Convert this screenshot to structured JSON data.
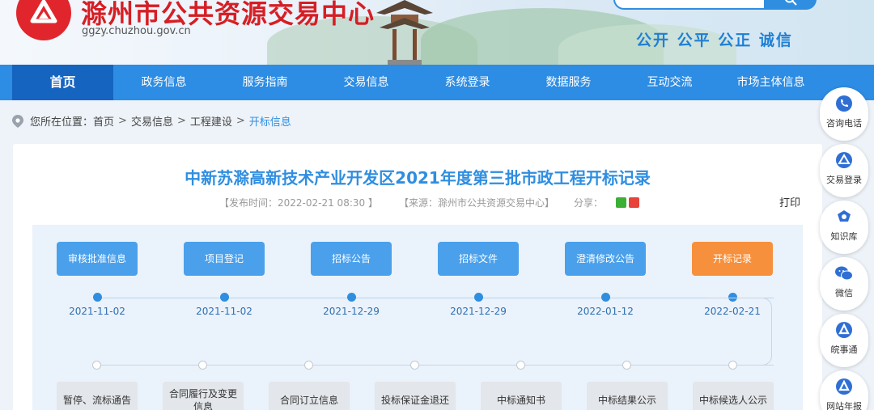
{
  "header": {
    "site_title": "滁州市公共资源交易中心",
    "domain": "ggzy.chuzhou.gov.cn",
    "slogan": "公开 公平 公正 诚信",
    "search_placeholder": "",
    "colors": {
      "title": "#d61e24",
      "accent": "#2f8ee0"
    }
  },
  "nav": {
    "items": [
      "首页",
      "政务信息",
      "服务指南",
      "交易信息",
      "系统登录",
      "数据服务",
      "互动交流",
      "市场主体信息"
    ],
    "active_index": 0
  },
  "breadcrumb": {
    "prefix": "您所在位置：",
    "items": [
      "首页",
      "交易信息",
      "工程建设",
      "开标信息"
    ],
    "separator": ">"
  },
  "article": {
    "title": "中新苏滁高新技术产业开发区2021年度第三批市政工程开标记录",
    "publish_time": "【发布时间：2022-02-21 08:30 】",
    "source": "【来源：滁州市公共资源交易中心】",
    "share_label": "分享：",
    "print_label": "打印"
  },
  "flow": {
    "stages": [
      {
        "label": "审核批准信息",
        "date": "2021-11-02",
        "active": false
      },
      {
        "label": "项目登记",
        "date": "2021-11-02",
        "active": false
      },
      {
        "label": "招标公告",
        "date": "2021-12-29",
        "active": false
      },
      {
        "label": "招标文件",
        "date": "2021-12-29",
        "active": false
      },
      {
        "label": "澄清修改公告",
        "date": "2022-01-12",
        "active": false
      },
      {
        "label": "开标记录",
        "date": "2022-02-21",
        "active": true
      }
    ],
    "later_stages": [
      "暂停、流标通告",
      "合同履行及变更信息",
      "合同订立信息",
      "投标保证金退还",
      "中标通知书",
      "中标结果公示",
      "中标候选人公示"
    ]
  },
  "sidebar": {
    "items": [
      {
        "label": "咨询电话",
        "icon": "phone-icon"
      },
      {
        "label": "交易登录",
        "icon": "logo-icon"
      },
      {
        "label": "知识库",
        "icon": "knowledge-icon"
      },
      {
        "label": "微信",
        "icon": "wechat-icon"
      },
      {
        "label": "皖事通",
        "icon": "wanshitong-icon"
      },
      {
        "label": "网站年报",
        "icon": "annual-report-icon"
      }
    ]
  }
}
